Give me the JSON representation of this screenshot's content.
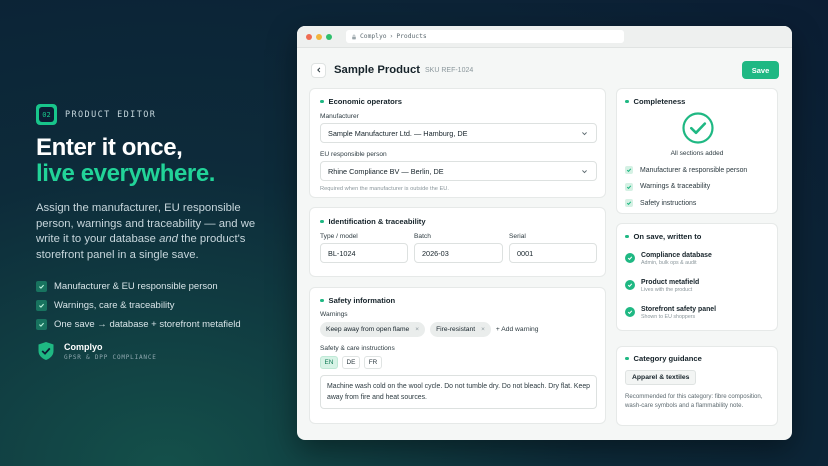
{
  "hero": {
    "tag_number": "02",
    "tag_label": "PRODUCT EDITOR",
    "headline_line1": "Enter it once,",
    "headline_line2": "live everywhere.",
    "desc_part1": "Assign the manufacturer, EU responsible person, warnings and traceability — and we write it to your database ",
    "desc_emphasis": "and",
    "desc_part2": " the product's storefront panel in a single save.",
    "checks": [
      "Manufacturer & EU responsible person",
      "Warnings, care & traceability",
      "One save → database + storefront metafield"
    ]
  },
  "brand": {
    "name": "Complyo",
    "subtitle": "GPSR & DPP COMPLIANCE"
  },
  "browser": {
    "breadcrumb_app": "Complyo",
    "breadcrumb_sep": "›",
    "breadcrumb_page": "Products"
  },
  "page": {
    "title": "Sample Product",
    "sku": "SKU REF-1024",
    "save_label": "Save"
  },
  "economic": {
    "title": "Economic operators",
    "manufacturer_label": "Manufacturer",
    "manufacturer_value": "Sample Manufacturer Ltd. — Hamburg, DE",
    "eu_label": "EU responsible person",
    "eu_value": "Rhine Compliance BV — Berlin, DE",
    "hint": "Required when the manufacturer is outside the EU."
  },
  "identification": {
    "title": "Identification & traceability",
    "type_label": "Type / model",
    "type_value": "BL-1024",
    "batch_label": "Batch",
    "batch_value": "2026-03",
    "serial_label": "Serial",
    "serial_value": "0001"
  },
  "safety": {
    "title": "Safety information",
    "warnings_label": "Warnings",
    "chips": [
      "Keep away from open flame",
      "Fire-resistant"
    ],
    "add_warning": "+ Add warning",
    "care_label": "Safety & care instructions",
    "languages": [
      "EN",
      "DE",
      "FR"
    ],
    "instructions": "Machine wash cold on the wool cycle. Do not tumble dry. Do not bleach. Dry flat. Keep away from fire and heat sources."
  },
  "completeness": {
    "title": "Completeness",
    "status": "All sections added",
    "items": [
      "Manufacturer & responsible person",
      "Warnings & traceability",
      "Safety instructions"
    ]
  },
  "on_save": {
    "title": "On save, written to",
    "items": [
      {
        "title": "Compliance database",
        "sub": "Admin, bulk ops & audit"
      },
      {
        "title": "Product metafield",
        "sub": "Lives with the product"
      },
      {
        "title": "Storefront safety panel",
        "sub": "Shown to EU shoppers"
      }
    ]
  },
  "category": {
    "title": "Category guidance",
    "badge": "Apparel & textiles",
    "text": "Recommended for this category: fibre composition, wash-care symbols and a flammability note."
  },
  "colors": {
    "accent": "#1fb883",
    "bg_dark": "#0b1d33",
    "headline_accent": "#22d398"
  }
}
